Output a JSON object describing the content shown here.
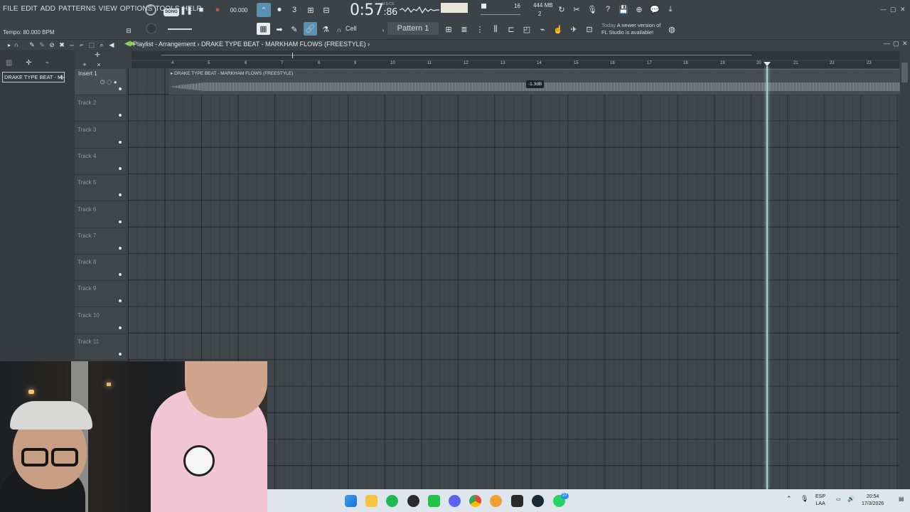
{
  "menu": [
    "FILE",
    "EDIT",
    "ADD",
    "PATTERNS",
    "VIEW",
    "OPTIONS",
    "TOOLS",
    "HELP"
  ],
  "transport": {
    "song_label": "SONG",
    "time_main": "0:57",
    "time_sub": ":86",
    "time_unit": "M:S:CS",
    "tempo_readout": "00.000"
  },
  "tempo_label": "Tempo: 80.000 BPM",
  "resources": {
    "memory": "444 MB",
    "cpu": "2",
    "step": "16"
  },
  "pattern": {
    "snap": "Cell",
    "current": "Pattern 1"
  },
  "news": {
    "today": "Today",
    "line1": "A newer version of",
    "line2": "FL Studio is available!"
  },
  "playlist": {
    "title": "Playlist - Arrangement",
    "song_name": "DRAKE TYPE BEAT - MARKHAM FLOWS (FREESTYLE)",
    "picker_item": "DRAKE TYPE BEAT - M...",
    "insert": "Insert 1",
    "clip_title": "DRAKE TYPE BEAT - MARKHAM FLOWS (FREESTYLE)",
    "clip_level": "-1.3dB",
    "bars": [
      "4",
      "5",
      "6",
      "7",
      "8",
      "9",
      "10",
      "11",
      "12",
      "13",
      "14",
      "15",
      "16",
      "17",
      "18",
      "19",
      "20",
      "21",
      "22",
      "23"
    ],
    "tracks": [
      "Track 2",
      "Track 3",
      "Track 4",
      "Track 5",
      "Track 6",
      "Track 7",
      "Track 8",
      "Track 9",
      "Track 10",
      "Track 11"
    ]
  },
  "taskbar": {
    "lang_top": "ESP",
    "lang_bottom": "LAA",
    "clock_time": "20:54",
    "clock_date": "17/3/2026",
    "whatsapp_badge": "27"
  }
}
